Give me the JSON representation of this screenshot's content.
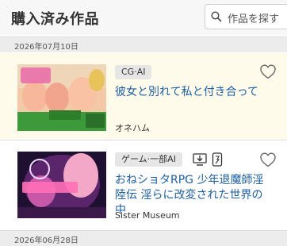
{
  "header": {
    "title": "購入済み作品",
    "search_placeholder": "作品を探す"
  },
  "groups": [
    {
      "date": "2026年07月10日",
      "items": [
        {
          "tag": "CG·AI",
          "title": "彼女と別れて私と付き合って",
          "circle": "オネハム",
          "favorited": false
        }
      ]
    },
    {
      "date": "2026年06月28日",
      "items": [
        {
          "tag": "ゲーム·一部AI",
          "title": "おねショタRPG 少年退魔師淫陸伝 淫らに改変された世界の中",
          "circle": "Sister Museum",
          "favorited": false,
          "features": [
            "download-icon",
            "mobile-icon"
          ]
        }
      ]
    }
  ],
  "colors": {
    "highlight_row": "#fffbeb",
    "title_link": "#1a5fa8",
    "date_bar": "#ececec"
  }
}
